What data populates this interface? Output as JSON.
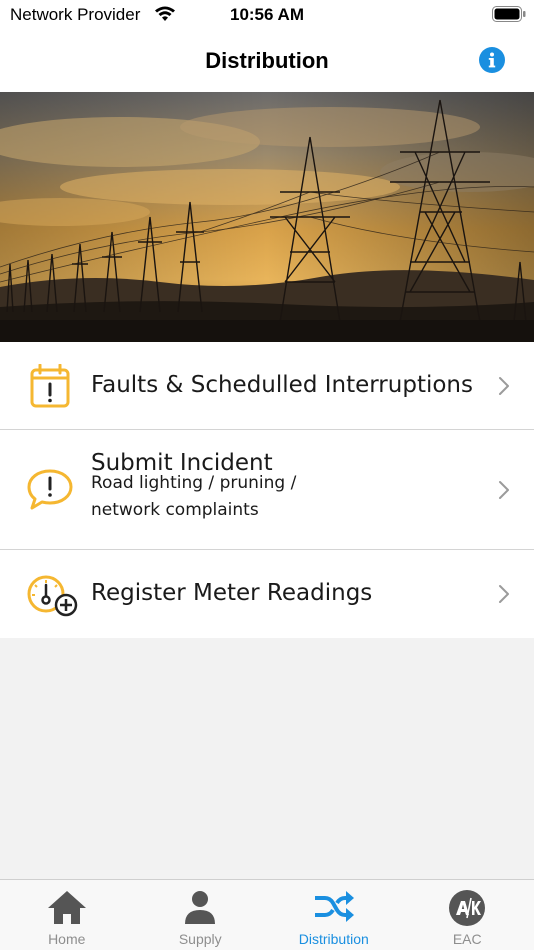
{
  "status_bar": {
    "carrier": "Network Provider",
    "time": "10:56 AM"
  },
  "nav": {
    "title": "Distribution"
  },
  "menu": {
    "items": [
      {
        "title": "Faults & Schedulled Interruptions",
        "icon": "calendar-alert-icon"
      },
      {
        "title": "Submit Incident",
        "subtitle_line1": "Road lighting / pruning /",
        "subtitle_line2": "network complaints",
        "icon": "speech-bubble-alert-icon"
      },
      {
        "title": "Register Meter Readings",
        "icon": "meter-add-icon"
      }
    ]
  },
  "tabs": [
    {
      "label": "Home",
      "icon": "home-icon"
    },
    {
      "label": "Supply",
      "icon": "person-icon"
    },
    {
      "label": "Distribution",
      "icon": "shuffle-icon",
      "active": true
    },
    {
      "label": "EAC",
      "icon": "eac-logo-icon"
    }
  ],
  "colors": {
    "accent": "#1a8fe0",
    "icon_orange": "#f5b731",
    "inactive": "#8e8e8e"
  }
}
